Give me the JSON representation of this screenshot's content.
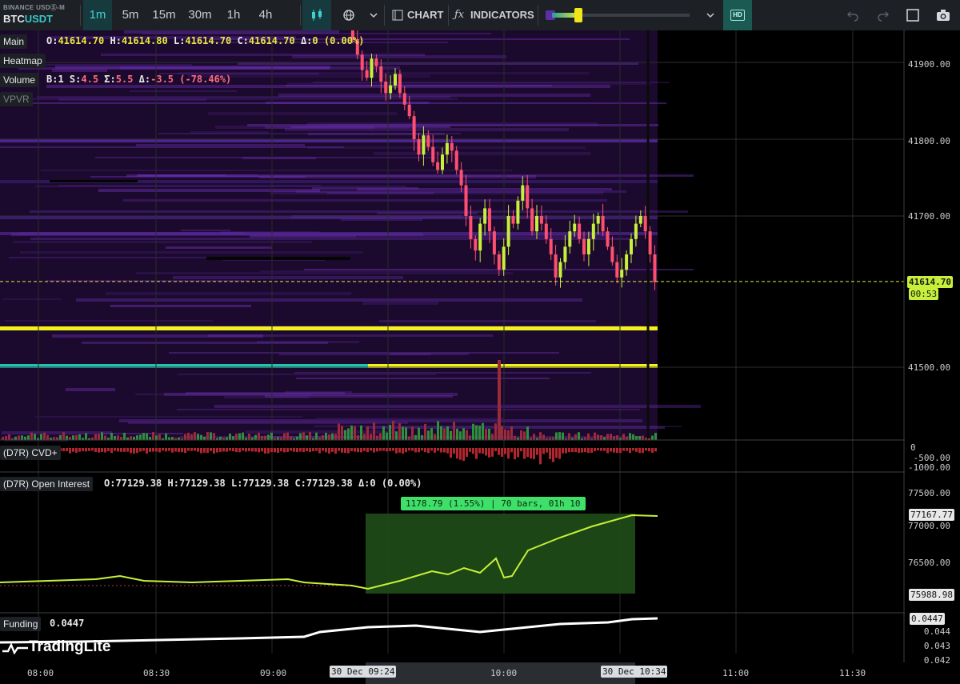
{
  "header": {
    "exchange": "BINANCE USDⓈ-M",
    "symbol_base": "BTC",
    "symbol_quote": "USDT",
    "timeframes": [
      "1m",
      "5m",
      "15m",
      "30m",
      "1h",
      "4h"
    ],
    "active_timeframe": "1m",
    "chart_label": "CHART",
    "indicators_label": "INDICATORS",
    "hd_label": "HD"
  },
  "main_panel": {
    "label": "Main",
    "ohlc": {
      "o": "41614.70",
      "h": "41614.80",
      "l": "41614.70",
      "c": "41614.70",
      "delta": "0 (0.00%)"
    },
    "layers": [
      "Heatmap",
      "Volume",
      "VPVR"
    ],
    "volume_stats": {
      "b": "1",
      "s": "4.5",
      "sigma": "5.5",
      "delta": "-3.5 (-78.46%)"
    },
    "price_axis": [
      "41900.00",
      "41800.00",
      "41700.00",
      "41500.00"
    ],
    "last_price": "41614.70",
    "countdown": "00:53",
    "colors": {
      "bull": "#c6f03a",
      "bear": "#ff4f6f",
      "heatmap_bg": "#1c0a2e",
      "yellow_line": "#f2f21a",
      "teal_line": "#23c2b0"
    }
  },
  "cvd_panel": {
    "label": "(D7R) CVD+",
    "axis": [
      "0",
      "-500.00",
      "-1000.00"
    ]
  },
  "oi_panel": {
    "label": "(D7R) Open Interest",
    "ohlc": {
      "o": "77129.38",
      "h": "77129.38",
      "l": "77129.38",
      "c": "77129.38",
      "delta": "0 (0.00%)"
    },
    "axis": [
      "77500.00",
      "77000.00",
      "76500.00"
    ],
    "last_value": "77167.77",
    "low_value": "75988.98",
    "measure_label": "1178.79 (1.55%) | 70 bars, 01h 10"
  },
  "funding_panel": {
    "label": "Funding",
    "value": "0.0447",
    "axis": [
      "0.044",
      "0.043",
      "0.042"
    ],
    "last_value": "0.0447"
  },
  "watermark": "TradingLite",
  "time_axis": {
    "labels": [
      "08:00",
      "08:30",
      "09:00",
      "10:00",
      "11:00",
      "11:30"
    ],
    "cursor_start": "30 Dec 09:24",
    "cursor_end": "30 Dec 10:34"
  }
}
